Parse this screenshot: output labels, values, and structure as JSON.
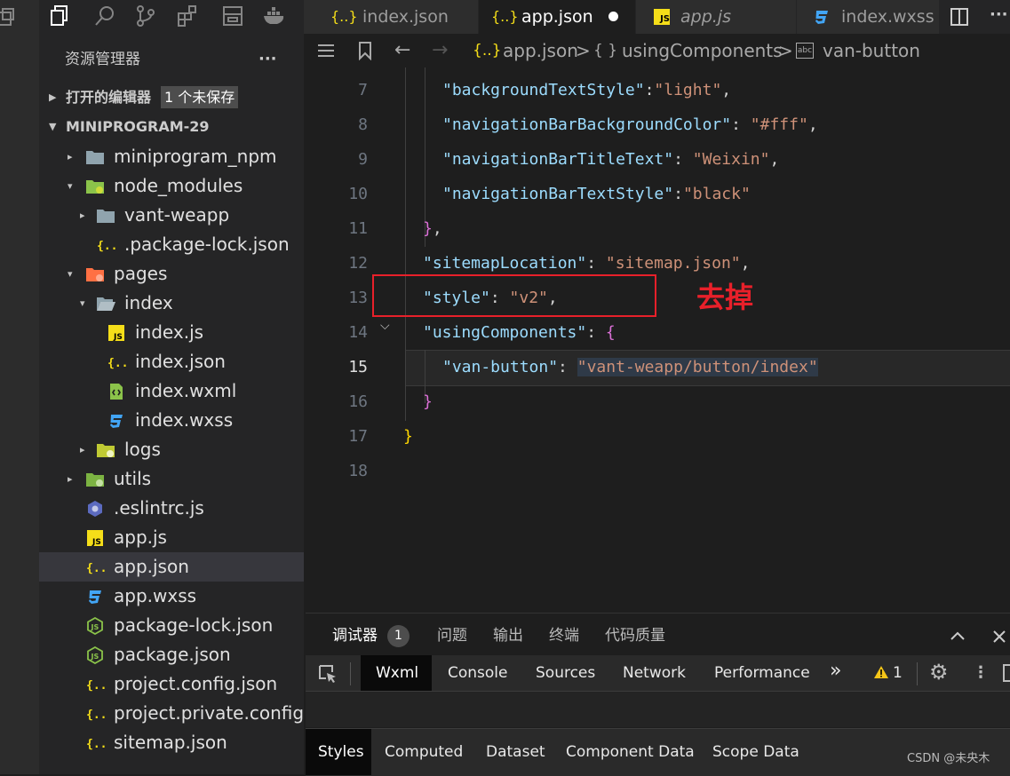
{
  "sidebar": {
    "title": "资源管理器",
    "more": "···",
    "open_editors": {
      "label": "打开的编辑器",
      "badge": "1 个未保存"
    },
    "project": "MINIPROGRAM-29",
    "tree": [
      {
        "label": "miniprogram_npm",
        "icon": "folder-icon",
        "twisty": "▸"
      },
      {
        "label": "node_modules",
        "icon": "folder-node-icon",
        "twisty": "▾"
      },
      {
        "label": "vant-weapp",
        "icon": "folder-icon",
        "twisty": "▸"
      },
      {
        "label": ".package-lock.json",
        "icon": "json-file-icon",
        "twisty": ""
      },
      {
        "label": "pages",
        "icon": "folder-pages-icon",
        "twisty": "▾"
      },
      {
        "label": "index",
        "icon": "folder-open-icon",
        "twisty": "▾"
      },
      {
        "label": "index.js",
        "icon": "js-file-icon",
        "twisty": ""
      },
      {
        "label": "index.json",
        "icon": "json-file-icon",
        "twisty": ""
      },
      {
        "label": "index.wxml",
        "icon": "wxml-file-icon",
        "twisty": ""
      },
      {
        "label": "index.wxss",
        "icon": "css-file-icon",
        "twisty": ""
      },
      {
        "label": "logs",
        "icon": "folder-logs-icon",
        "twisty": "▸"
      },
      {
        "label": "utils",
        "icon": "folder-utils-icon",
        "twisty": "▸"
      },
      {
        "label": ".eslintrc.js",
        "icon": "eslint-file-icon",
        "twisty": ""
      },
      {
        "label": "app.js",
        "icon": "js-file-icon",
        "twisty": ""
      },
      {
        "label": "app.json",
        "icon": "json-file-icon",
        "twisty": ""
      },
      {
        "label": "app.wxss",
        "icon": "css-file-icon",
        "twisty": ""
      },
      {
        "label": "package-lock.json",
        "icon": "node-js-file-icon",
        "twisty": ""
      },
      {
        "label": "package.json",
        "icon": "node-js-file-icon",
        "twisty": ""
      },
      {
        "label": "project.config.json",
        "icon": "json-file-icon",
        "twisty": ""
      },
      {
        "label": "project.private.config...",
        "icon": "json-file-icon",
        "twisty": ""
      },
      {
        "label": "sitemap.json",
        "icon": "json-file-icon",
        "twisty": ""
      }
    ]
  },
  "tabs": [
    {
      "icon": "{..}",
      "label": "index.json"
    },
    {
      "icon": "{..}",
      "label": "app.json"
    },
    {
      "icon": "JS",
      "label": "app.js"
    },
    {
      "icon": "3",
      "label": "index.wxss"
    }
  ],
  "tabs_more": "···",
  "breadcrumb": {
    "file_icon": "{..}",
    "file": "app.json",
    "sep": ">",
    "obj_icon": "{ }",
    "section": "usingComponents",
    "leaf_icon": "abc",
    "leaf": "van-button"
  },
  "editor": {
    "lines": [
      {
        "n": "7",
        "tokens": [
          [
            "k",
            "\"backgroundTextStyle\""
          ],
          [
            "p",
            ":"
          ],
          [
            "s",
            "\"light\""
          ],
          [
            "p",
            ","
          ]
        ]
      },
      {
        "n": "8",
        "tokens": [
          [
            "k",
            "\"navigationBarBackgroundColor\""
          ],
          [
            "p",
            ": "
          ],
          [
            "s",
            "\"#fff\""
          ],
          [
            "p",
            ","
          ]
        ]
      },
      {
        "n": "9",
        "tokens": [
          [
            "k",
            "\"navigationBarTitleText\""
          ],
          [
            "p",
            ": "
          ],
          [
            "s",
            "\"Weixin\""
          ],
          [
            "p",
            ","
          ]
        ]
      },
      {
        "n": "10",
        "tokens": [
          [
            "k",
            "\"navigationBarTextStyle\""
          ],
          [
            "p",
            ":"
          ],
          [
            "s",
            "\"black\""
          ]
        ]
      },
      {
        "n": "11",
        "tokens": [
          [
            "b",
            "}"
          ],
          [
            "p",
            ","
          ]
        ]
      },
      {
        "n": "12",
        "tokens": [
          [
            "k",
            "\"sitemapLocation\""
          ],
          [
            "p",
            ": "
          ],
          [
            "s",
            "\"sitemap.json\""
          ],
          [
            "p",
            ","
          ]
        ]
      },
      {
        "n": "13",
        "tokens": [
          [
            "k",
            "\"style\""
          ],
          [
            "p",
            ": "
          ],
          [
            "s",
            "\"v2\""
          ],
          [
            "p",
            ","
          ]
        ]
      },
      {
        "n": "14",
        "tokens": [
          [
            "k",
            "\"usingComponents\""
          ],
          [
            "p",
            ": "
          ],
          [
            "b",
            "{"
          ]
        ]
      },
      {
        "n": "15",
        "tokens": [
          [
            "k",
            "\"van-button\""
          ],
          [
            "p",
            ": "
          ],
          [
            "s",
            "\"vant-weapp/button/index\""
          ]
        ]
      },
      {
        "n": "16",
        "tokens": [
          [
            "b",
            "}"
          ]
        ]
      },
      {
        "n": "17",
        "tokens": [
          [
            "y",
            "}"
          ]
        ]
      },
      {
        "n": "18",
        "tokens": []
      }
    ],
    "annotation": "去掉"
  },
  "panel": {
    "tabs": [
      "调试器",
      "问题",
      "输出",
      "终端",
      "代码质量"
    ],
    "debugger_badge": "1",
    "devtools_tabs": [
      "Wxml",
      "Console",
      "Sources",
      "Network",
      "Performance"
    ],
    "overflow": "»",
    "warnings": "1",
    "sub_tabs": [
      "Styles",
      "Computed",
      "Dataset",
      "Component Data",
      "Scope Data"
    ]
  },
  "watermark": "CSDN @未央木",
  "colors": {
    "accent_red": "#e8202a",
    "selected_row": "#37373d",
    "js_yellow": "#f5de19",
    "css_blue": "#42a5f5"
  }
}
